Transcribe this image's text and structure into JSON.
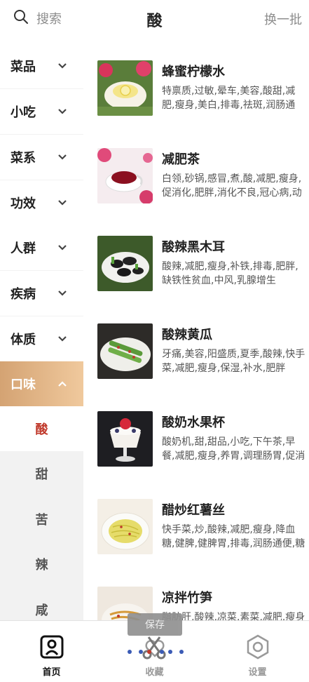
{
  "header": {
    "search_label": "搜索",
    "title": "酸",
    "refresh_label": "换一批"
  },
  "sidebar": {
    "categories": [
      {
        "label": "菜品"
      },
      {
        "label": "小吃"
      },
      {
        "label": "菜系"
      },
      {
        "label": "功效"
      },
      {
        "label": "人群"
      },
      {
        "label": "疾病"
      },
      {
        "label": "体质"
      },
      {
        "label": "口味"
      }
    ],
    "sub_items": [
      {
        "label": "酸"
      },
      {
        "label": "甜"
      },
      {
        "label": "苦"
      },
      {
        "label": "辣"
      },
      {
        "label": "咸"
      }
    ]
  },
  "recipes": [
    {
      "name": "蜂蜜柠檬水",
      "tags": "特禀质,过敏,晕车,美容,酸甜,减肥,瘦身,美白,排毒,祛斑,润肠通便,祛"
    },
    {
      "name": "减肥茶",
      "tags": "白领,砂锅,感冒,煮,酸,减肥,瘦身,促消化,肥胖,消化不良,冠心病,动脉"
    },
    {
      "name": "酸辣黑木耳",
      "tags": "酸辣,减肥,瘦身,补铁,排毒,肥胖,缺铁性贫血,中风,乳腺增生"
    },
    {
      "name": "酸辣黄瓜",
      "tags": "牙痛,美容,阳盛质,夏季,酸辣,快手菜,减肥,瘦身,保湿,补水,肥胖"
    },
    {
      "name": "酸奶水果杯",
      "tags": "酸奶机,甜,甜品,小吃,下午茶,早餐,减肥,瘦身,养胃,调理肠胃,促消化,"
    },
    {
      "name": "醋炒红薯丝",
      "tags": "快手菜,炒,酸辣,减肥,瘦身,降血糖,健脾,健脾胃,排毒,润肠通便,糖尿"
    },
    {
      "name": "凉拌竹笋",
      "tags": "脂肪肝,酸辣,凉菜,素菜,减肥,瘦身"
    }
  ],
  "bottom_nav": [
    {
      "label": "首页",
      "icon": "home-icon"
    },
    {
      "label": "收藏",
      "icon": "favorite-icon"
    },
    {
      "label": "设置",
      "icon": "settings-icon"
    }
  ],
  "overlay": {
    "save_label": "保存"
  },
  "colors": {
    "accent_gradient_start": "#d4a373",
    "accent_gradient_end": "#f0c99d",
    "selected_red": "#c0392b"
  }
}
